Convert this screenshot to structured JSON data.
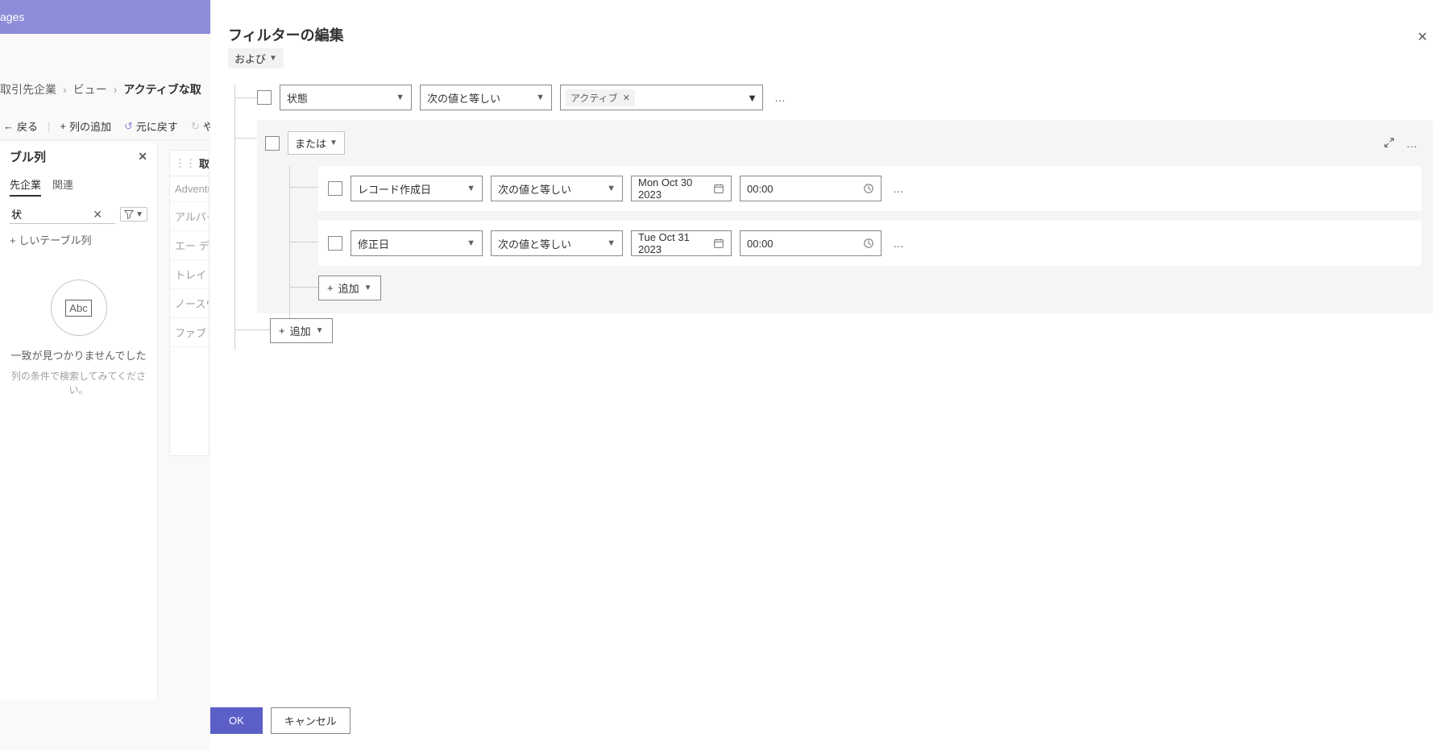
{
  "topbar": {
    "brand": "ages"
  },
  "crumbs": {
    "c1": "取引先企業",
    "c2": "ビュー",
    "c3": "アクティブな取"
  },
  "toolbar": {
    "back": "戻る",
    "add_col": "列の追加",
    "undo": "元に戻す",
    "redo": "やり"
  },
  "side": {
    "title": "ブル列",
    "tab1": "先企業",
    "tab2": "関連",
    "search_value": "状",
    "newcol": "しいテーブル列",
    "abc": "Abc",
    "msg1": "一致が見つかりませんでした",
    "msg2": "列の条件で検索してみてください。"
  },
  "datalist": {
    "header": "取引先企",
    "rows": [
      "Adventur",
      "アルパイ",
      "エー デー",
      "トレイ リ",
      "ノースウ",
      "ファブリ"
    ]
  },
  "panel": {
    "title": "フィルターの編集",
    "and": "および",
    "row1": {
      "field": "状態",
      "op": "次の値と等しい",
      "val_chip": "アクティブ"
    },
    "or_group": {
      "label": "または",
      "rows": [
        {
          "field": "レコード作成日",
          "op": "次の値と等しい",
          "date": "Mon Oct 30 2023",
          "time": "00:00"
        },
        {
          "field": "修正日",
          "op": "次の値と等しい",
          "date": "Tue Oct 31 2023",
          "time": "00:00"
        }
      ],
      "add": "追加"
    },
    "outer_add": "追加",
    "ok": "OK",
    "cancel": "キャンセル"
  }
}
